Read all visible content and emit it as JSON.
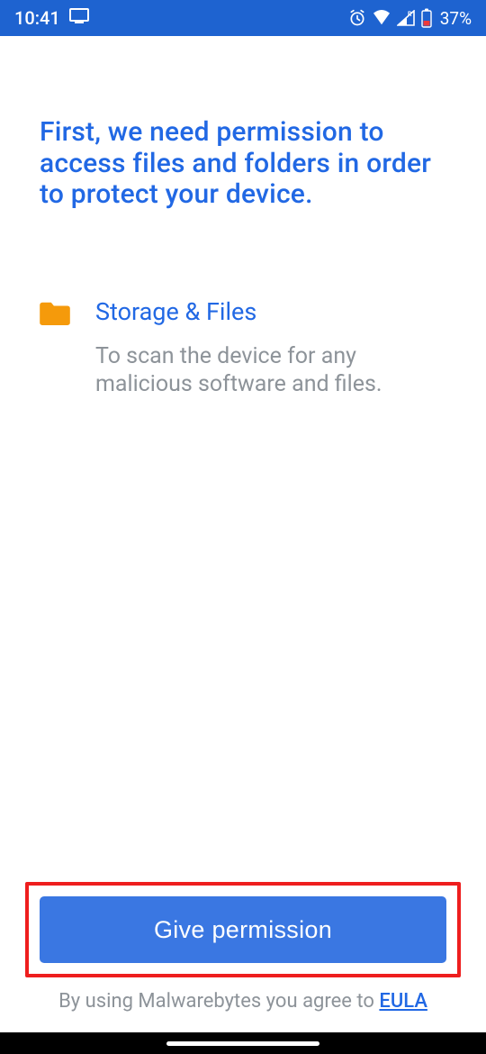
{
  "status": {
    "time": "10:41",
    "battery_pct": "37%"
  },
  "headline": "First, we need permission to access files and folders in order to protect your device.",
  "perm": {
    "title": "Storage & Files",
    "desc": "To scan the device for any malicious software and files."
  },
  "action": {
    "button_label": "Give permission"
  },
  "footer": {
    "agree_prefix": "By using Malwarebytes you agree to ",
    "eula_label": "EULA"
  },
  "colors": {
    "primary": "#2168e4",
    "accent_orange": "#f59a0b",
    "highlight_border": "#ee1e1e"
  }
}
